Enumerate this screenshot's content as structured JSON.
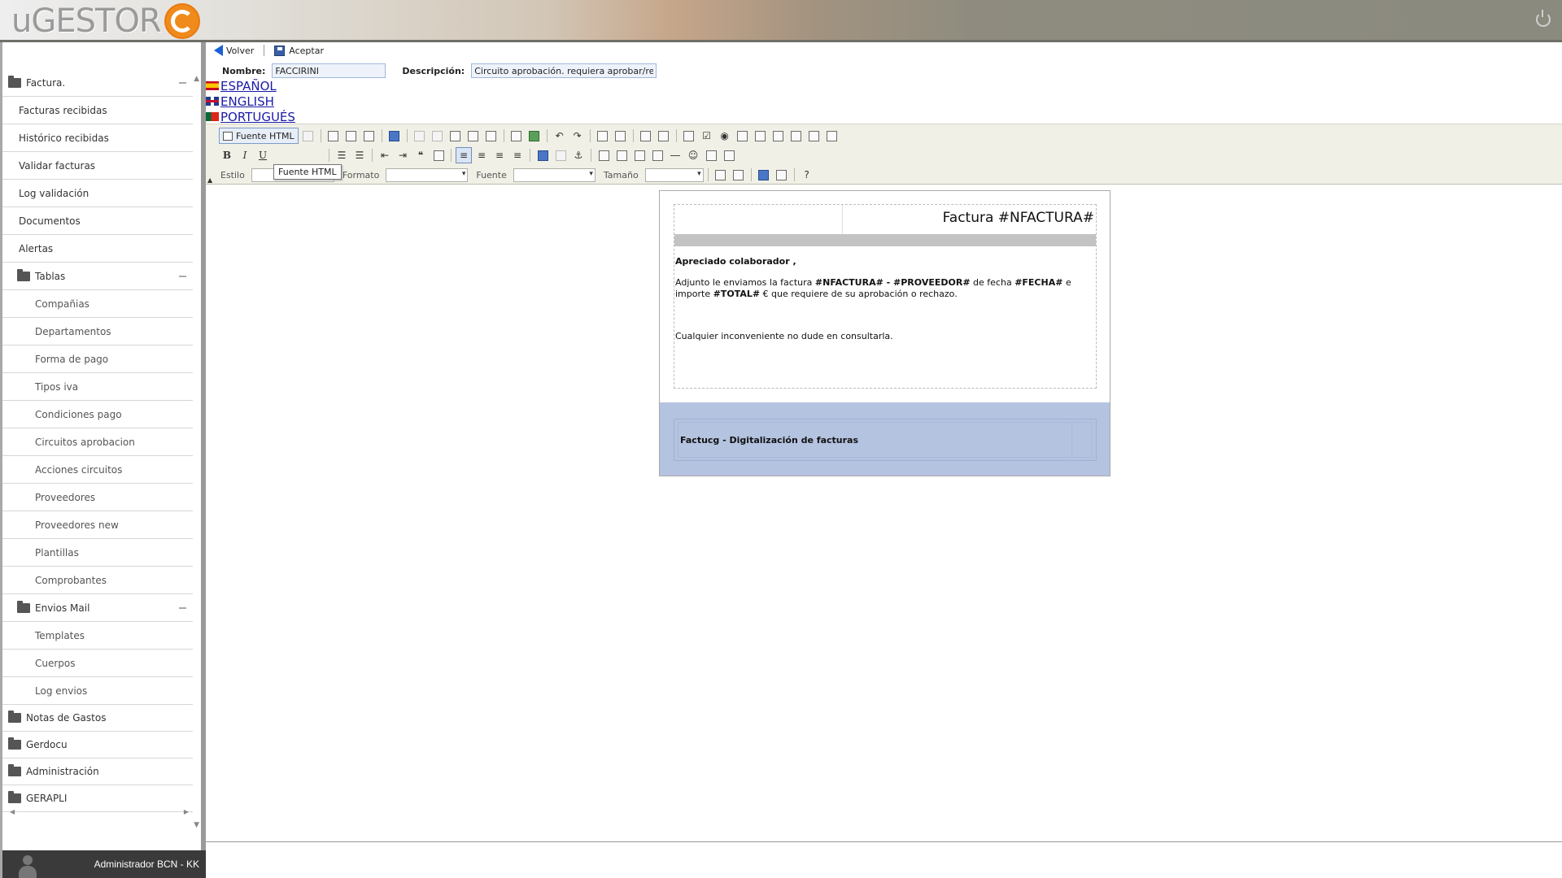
{
  "app": {
    "logo_text": "uGESTOR",
    "brand_color": "#f08a1a"
  },
  "header": {
    "power_icon": "power-icon"
  },
  "sidebar": {
    "items": [
      {
        "label": "Factura.",
        "level": 0,
        "folder": true,
        "collapsible": true
      },
      {
        "label": "Facturas recibidas",
        "level": 1
      },
      {
        "label": "Histórico recibidas",
        "level": 1
      },
      {
        "label": "Validar facturas",
        "level": 1
      },
      {
        "label": "Log validación",
        "level": 1
      },
      {
        "label": "Documentos",
        "level": 1
      },
      {
        "label": "Alertas",
        "level": 1
      },
      {
        "label": "Tablas",
        "level": 1,
        "folder": true,
        "collapsible": true
      },
      {
        "label": "Compañias",
        "level": 2
      },
      {
        "label": "Departamentos",
        "level": 2
      },
      {
        "label": "Forma de pago",
        "level": 2
      },
      {
        "label": "Tipos iva",
        "level": 2
      },
      {
        "label": "Condiciones pago",
        "level": 2
      },
      {
        "label": "Circuitos aprobacion",
        "level": 2
      },
      {
        "label": "Acciones circuitos",
        "level": 2
      },
      {
        "label": "Proveedores",
        "level": 2
      },
      {
        "label": "Proveedores new",
        "level": 2
      },
      {
        "label": "Plantillas",
        "level": 2
      },
      {
        "label": "Comprobantes",
        "level": 2
      },
      {
        "label": "Envios Mail",
        "level": 1,
        "folder": true,
        "collapsible": true
      },
      {
        "label": "Templates",
        "level": 2
      },
      {
        "label": "Cuerpos",
        "level": 2
      },
      {
        "label": "Log envios",
        "level": 2
      },
      {
        "label": "Notas de Gastos",
        "level": 0,
        "folder": true
      },
      {
        "label": "Gerdocu",
        "level": 0,
        "folder": true
      },
      {
        "label": "Administración",
        "level": 0,
        "folder": true
      },
      {
        "label": "GERAPLI",
        "level": 0,
        "folder": true
      }
    ]
  },
  "user": {
    "name": "Administrador BCN - KK"
  },
  "actions": {
    "back_label": "Volver",
    "accept_label": "Aceptar"
  },
  "form": {
    "nombre_label": "Nombre:",
    "nombre_value": "FACCIRINI",
    "descripcion_label": "Descripción:",
    "descripcion_value": "Circuito aprobación. requiera aprobar/re"
  },
  "languages": [
    {
      "label": " ESPAÑOL",
      "flag": "es"
    },
    {
      "label": " ENGLISH",
      "flag": "en"
    },
    {
      "label": " PORTUGUÉS",
      "flag": "pt"
    }
  ],
  "toolbar": {
    "source_label": "Fuente HTML",
    "tooltip": "Fuente HTML",
    "bold": "B",
    "italic": "I",
    "underline": "U",
    "estilo_label": "Estilo",
    "formato_label": "Formato",
    "fuente_label": "Fuente",
    "tamano_label": "Tamaño"
  },
  "email": {
    "title": "Factura #NFACTURA#",
    "greeting": "Apreciado colaborador ,",
    "line1_a": "Adjunto le enviamos la factura ",
    "line1_b": "#NFACTURA# - #PROVEEDOR#",
    "line1_c": " de fecha ",
    "line1_d": "#FECHA#",
    "line1_e": " e importe ",
    "line1_f": "#TOTAL#",
    "line1_g": " € que requiere de su aprobación o rechazo.",
    "closing": "Cualquier inconveniente no dude en consultarla.",
    "footer": "Factucg - Digitalización de facturas",
    "footer_color": "#b4c3e0"
  }
}
